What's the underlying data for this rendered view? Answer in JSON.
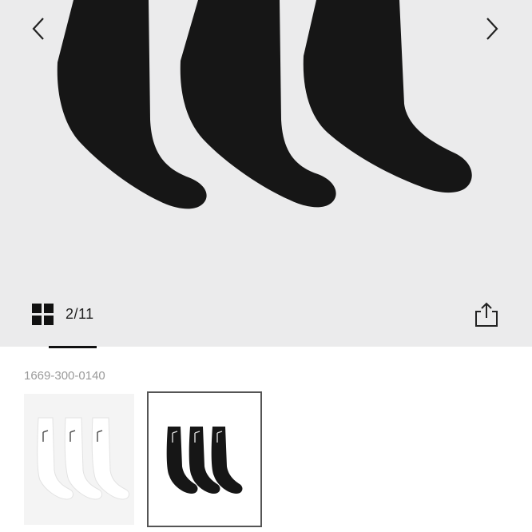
{
  "gallery": {
    "counter": "2/11",
    "main_image": "black-crew-socks-three-pack",
    "icons": {
      "prev": "chevron-left-icon",
      "next": "chevron-right-icon",
      "grid": "grid-view-icon",
      "share": "share-icon"
    }
  },
  "product": {
    "code": "1669-300-0140"
  },
  "thumbnails": [
    {
      "image": "white-crew-socks-three-pack",
      "selected": false
    },
    {
      "image": "black-crew-socks-three-pack",
      "selected": true
    }
  ],
  "colors": {
    "gallery_background": "#ebebec",
    "sock_black": "#161616",
    "selected_border": "#555555"
  }
}
